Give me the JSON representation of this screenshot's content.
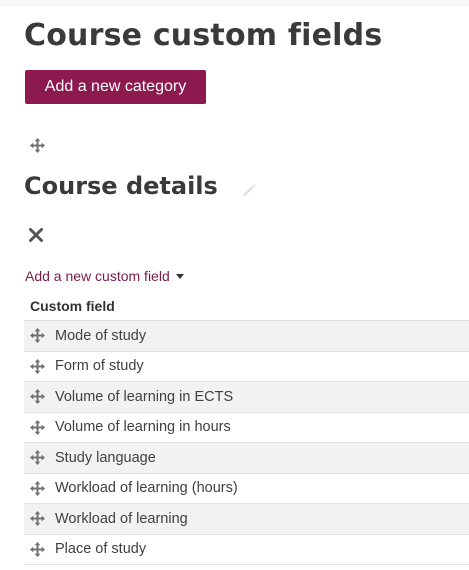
{
  "page": {
    "title": "Course custom fields"
  },
  "toolbar": {
    "add_category_label": "Add a new category"
  },
  "category": {
    "title": "Course details",
    "add_field_label": "Add a new custom field"
  },
  "table": {
    "header": "Custom field",
    "rows": [
      "Mode of study",
      "Form of study",
      "Volume of learning in ECTS",
      "Volume of learning in hours",
      "Study language",
      "Workload of learning (hours)",
      "Workload of learning",
      "Place of study"
    ]
  },
  "colors": {
    "accent": "#8c1a4f",
    "link": "#7a1d45",
    "row_alt": "#f2f2f2"
  },
  "icons": [
    "move-icon",
    "pencil-icon",
    "delete-icon",
    "caret-down-icon"
  ]
}
